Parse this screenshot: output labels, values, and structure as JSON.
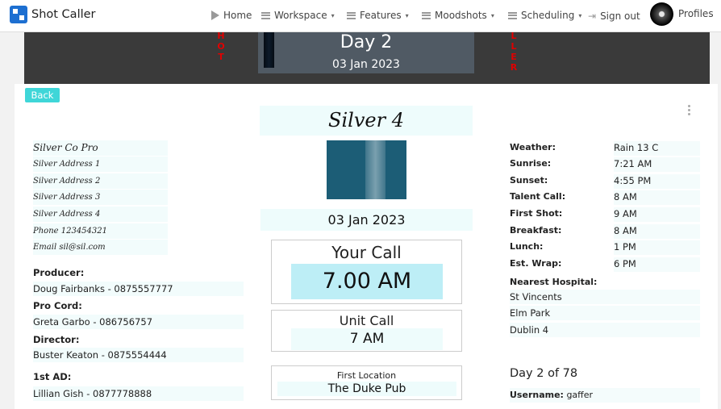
{
  "app": {
    "title": "Shot Caller"
  },
  "nav": {
    "home": "Home",
    "workspace": "Workspace",
    "features": "Features",
    "moodshots": "Moodshots",
    "scheduling": "Scheduling",
    "signout": "Sign out",
    "profiles": "Profiles"
  },
  "banner": {
    "day": "Day 2",
    "date": "03 Jan 2023",
    "left_letters": [
      "H",
      "O",
      "T"
    ],
    "right_letters": [
      "L",
      "L",
      "E",
      "R"
    ]
  },
  "back_label": "Back",
  "company": {
    "name": "Silver 4",
    "date": "03 Jan 2023"
  },
  "calls": {
    "your_call_label": "Your Call",
    "your_call_time": "7.00 AM",
    "unit_call_label": "Unit Call",
    "unit_call_time": "7 AM",
    "location_label": "First Location",
    "location_value": "The Duke Pub"
  },
  "contact": {
    "company": "Silver Co Pro",
    "address1": "Silver Address 1",
    "address2": "Silver Address 2",
    "address3": "Silver Address 3",
    "address4": "Silver Address 4",
    "phone": "Phone 123454321",
    "email": "Email sil@sil.com"
  },
  "crew": [
    {
      "role": "Producer:",
      "name": "Doug Fairbanks - 0875557777"
    },
    {
      "role": "Pro Cord:",
      "name": "Greta Garbo - 086756757"
    },
    {
      "role": "Director:",
      "name": "Buster Keaton - 0875554444"
    },
    {
      "role": "1st AD:",
      "name": "Lillian Gish - 0877778888"
    }
  ],
  "info": [
    {
      "label": "Weather:",
      "value": "Rain 13 C"
    },
    {
      "label": "Sunrise:",
      "value": "7:21 AM"
    },
    {
      "label": "Sunset:",
      "value": "4:55 PM"
    },
    {
      "label": "Talent Call:",
      "value": "8 AM"
    },
    {
      "label": "First Shot:",
      "value": "9 AM"
    },
    {
      "label": "Breakfast:",
      "value": "8 AM"
    },
    {
      "label": "Lunch:",
      "value": "1 PM"
    },
    {
      "label": "Est. Wrap:",
      "value": "6 PM"
    }
  ],
  "hospital": {
    "label": "Nearest Hospital:",
    "lines": [
      "St Vincents",
      "Elm Park",
      "Dublin 4"
    ]
  },
  "day_count": "Day 2 of 78",
  "username": {
    "label": "Username:",
    "value": "gaffer"
  }
}
